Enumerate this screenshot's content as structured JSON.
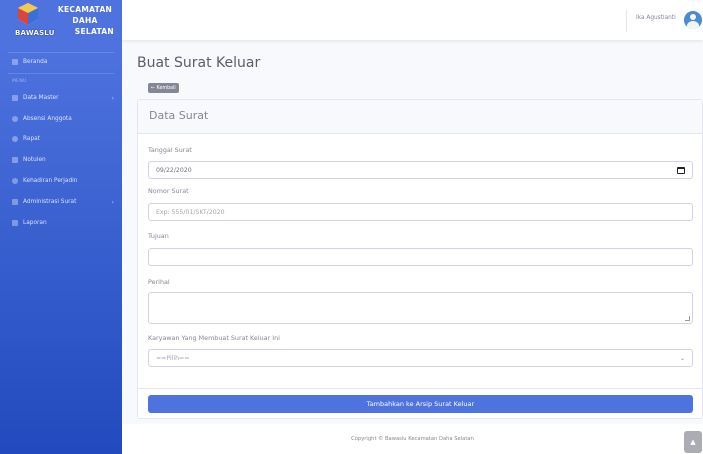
{
  "brand": {
    "line1": "KECAMATAN",
    "line2": "DAHA",
    "line3": "SELATAN",
    "logo_text": "BAWASLU"
  },
  "sidebar": {
    "beranda": "Beranda",
    "heading": "MENU",
    "items": [
      {
        "label": "Data Master",
        "icon": "folder-icon",
        "has_arrow": true
      },
      {
        "label": "Absensi Anggota",
        "icon": "user-check-icon",
        "has_arrow": false
      },
      {
        "label": "Rapat",
        "icon": "users-icon",
        "has_arrow": false
      },
      {
        "label": "Notulen",
        "icon": "file-icon",
        "has_arrow": false
      },
      {
        "label": "Kehadiran Perjadin",
        "icon": "car-icon",
        "has_arrow": false
      },
      {
        "label": "Administrasi Surat",
        "icon": "mail-icon",
        "has_arrow": true
      },
      {
        "label": "Laporan",
        "icon": "report-icon",
        "has_arrow": false
      }
    ],
    "arrow_glyph": "›"
  },
  "topbar": {
    "user_name": "Ika Agustianti"
  },
  "page": {
    "title": "Buat Surat Keluar",
    "back_label": "← Kembali"
  },
  "card": {
    "title": "Data Surat"
  },
  "form": {
    "tanggal_label": "Tanggal Surat",
    "tanggal_value": "09/22/2020",
    "nomor_label": "Nomor Surat",
    "nomor_placeholder": "Exp: 555/01/SKT/2020",
    "tujuan_label": "Tujuan",
    "tujuan_value": "",
    "perihal_label": "Perihal",
    "perihal_value": "",
    "karyawan_label": "Karyawan Yang Membuat Surat Keluar Ini",
    "karyawan_selected": "==Pilih==",
    "select_caret": "⌄",
    "submit_label": "Tambahkan ke Arsip Surat Keluar"
  },
  "footer": {
    "copyright": "Copyright © Bawaslu Kecamatan Daha Selatan",
    "scroll_top": "▲"
  },
  "colors": {
    "primary": "#4e73df",
    "primary_dark": "#224abe",
    "text_muted": "#858796"
  }
}
